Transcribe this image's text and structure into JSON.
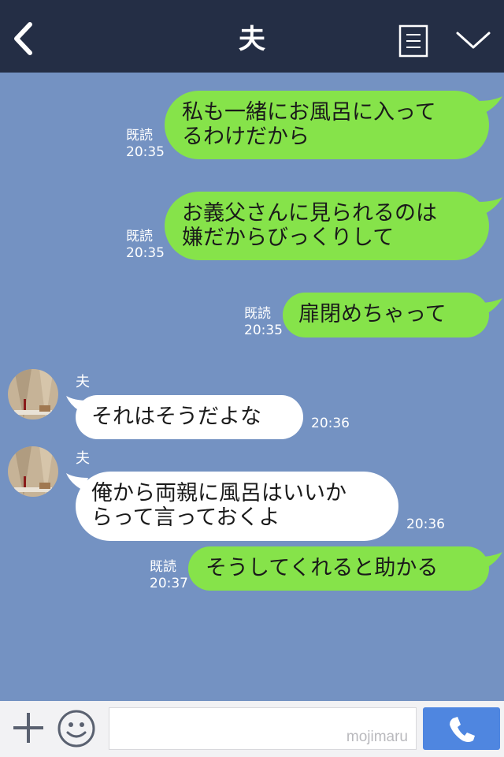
{
  "header": {
    "title": "夫"
  },
  "messages": [
    {
      "from": "me",
      "lines": [
        "私も一緒にお風呂に入って",
        "るわけだから"
      ],
      "read": "既読",
      "time": "20:35"
    },
    {
      "from": "me",
      "lines": [
        "お義父さんに見られるのは",
        "嫌だからびっくりして"
      ],
      "read": "既読",
      "time": "20:35"
    },
    {
      "from": "me",
      "lines": [
        "扉閉めちゃって"
      ],
      "read": "既読",
      "time": "20:35"
    },
    {
      "from": "them",
      "sender": "夫",
      "lines": [
        "それはそうだよな"
      ],
      "time": "20:36"
    },
    {
      "from": "them",
      "sender": "夫",
      "lines": [
        "俺から両親に風呂はいいか",
        "らって言っておくよ"
      ],
      "time": "20:36"
    },
    {
      "from": "me",
      "lines": [
        "そうしてくれると助かる"
      ],
      "read": "既読",
      "time": "20:37"
    }
  ],
  "footer": {
    "watermark": "mojimaru"
  },
  "colors": {
    "background": "#7492c2",
    "header": "#242e45",
    "my_bubble": "#86e34a",
    "their_bubble": "#ffffff",
    "call_button": "#4f86e0"
  },
  "icons": {
    "back": "chevron-left-icon",
    "notes": "notes-icon",
    "menu": "chevron-down-icon",
    "plus": "plus-icon",
    "emoji": "smiley-icon",
    "call": "phone-icon"
  }
}
